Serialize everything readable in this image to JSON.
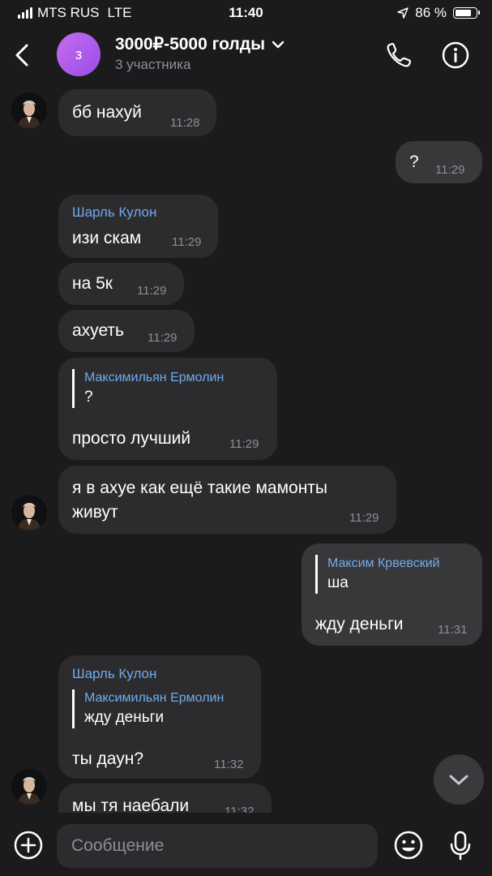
{
  "status": {
    "carrier": "MTS RUS",
    "network": "LTE",
    "time": "11:40",
    "battery": "86 %",
    "battery_level": 0.86
  },
  "header": {
    "avatar_letter": "з",
    "title": "3000₽-5000 голды",
    "subtitle": "3 участника"
  },
  "messages": [
    {
      "text": "бб нахуй",
      "time": "11:28"
    },
    {
      "text": "?",
      "time": "11:29"
    },
    {
      "sender": "Шарль Кулон",
      "text": "изи скам",
      "time": "11:29"
    },
    {
      "text": "на 5к",
      "time": "11:29"
    },
    {
      "text": "ахуеть",
      "time": "11:29"
    },
    {
      "quote_name": "Максимильян Ермолин",
      "quote_text": "?",
      "text": "просто лучший",
      "time": "11:29"
    },
    {
      "text_line1": "я в ахуе как ещё такие мамонты",
      "text_line2": "живут",
      "time": "11:29"
    },
    {
      "quote_name": "Максим Крвевский",
      "quote_text": "ша",
      "text": "жду деньги",
      "time": "11:31"
    },
    {
      "sender": "Шарль Кулон",
      "quote_name": "Максимильян Ермолин",
      "quote_text": "жду деньги",
      "text": "ты даун?",
      "time": "11:32"
    },
    {
      "text": "мы тя наебали",
      "time": "11:32"
    }
  ],
  "composer": {
    "placeholder": "Сообщение"
  },
  "icons": [
    "back-icon",
    "chevron-down-icon",
    "phone-icon",
    "info-icon",
    "chevron-down-icon",
    "add-icon",
    "emoji-icon",
    "microphone-icon"
  ],
  "colors": {
    "background": "#1b1b1d",
    "bubble": "#2c2c2e",
    "accent": "#71aaeb"
  }
}
